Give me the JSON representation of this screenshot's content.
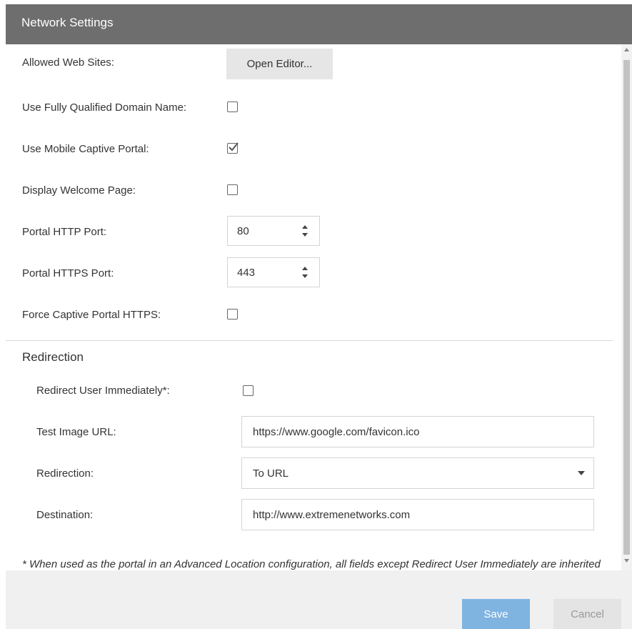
{
  "header": {
    "title": "Network Settings"
  },
  "fields": {
    "allowed_web_sites": {
      "label": "Allowed Web Sites:",
      "button": "Open Editor..."
    },
    "use_fqdn": {
      "label": "Use Fully Qualified Domain Name:",
      "checked": false
    },
    "use_mobile_captive_portal": {
      "label": "Use Mobile Captive Portal:",
      "checked": true
    },
    "display_welcome_page": {
      "label": "Display Welcome Page:",
      "checked": false
    },
    "portal_http_port": {
      "label": "Portal HTTP Port:",
      "value": "80"
    },
    "portal_https_port": {
      "label": "Portal HTTPS Port:",
      "value": "443"
    },
    "force_captive_portal_https": {
      "label": "Force Captive Portal HTTPS:",
      "checked": false
    }
  },
  "redirection": {
    "section_title": "Redirection",
    "redirect_immediately": {
      "label": "Redirect User Immediately*:",
      "checked": false
    },
    "test_image_url": {
      "label": "Test Image URL:",
      "value": "https://www.google.com/favicon.ico"
    },
    "redirection": {
      "label": "Redirection:",
      "value": "To URL"
    },
    "destination": {
      "label": "Destination:",
      "value": "http://www.extremenetworks.com"
    }
  },
  "footnote": "* When used as the portal in an Advanced Location configuration, all fields except Redirect User Immediately are inherited from the Access Control Configuration's base portal.",
  "footer": {
    "save": "Save",
    "cancel": "Cancel"
  },
  "colors": {
    "header_bg": "#6e6e6e",
    "save_bg": "#7fb3e0",
    "cancel_bg": "#e4e4e4"
  }
}
